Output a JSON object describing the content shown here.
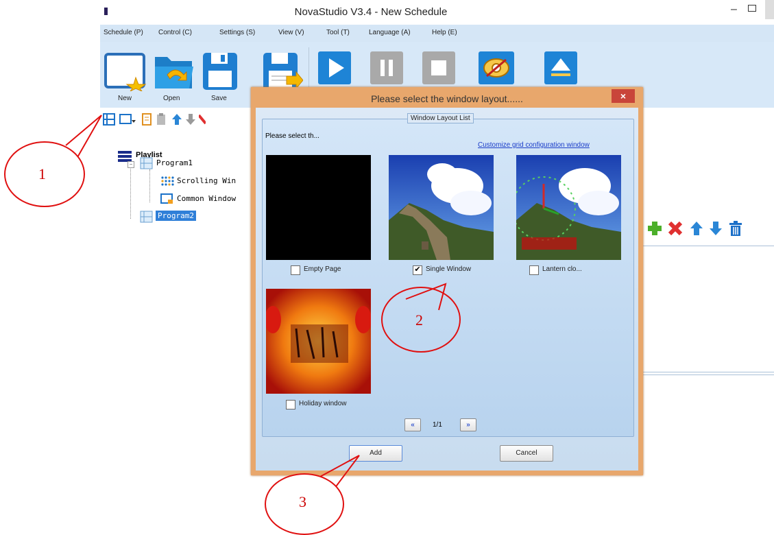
{
  "app": {
    "title": "NovaStudio V3.4 - New Schedule",
    "menu": [
      "Schedule (P)",
      "Control (C)",
      "Settings (S)",
      "View (V)",
      "Tool (T)",
      "Language (A)",
      "Help (E)"
    ],
    "toolbar": [
      {
        "label": "New",
        "icon": "new-window-icon"
      },
      {
        "label": "Open",
        "icon": "folder-open-icon"
      },
      {
        "label": "Save",
        "icon": "floppy-save-icon"
      },
      {
        "label": "",
        "icon": "save-as-icon"
      },
      {
        "label": "",
        "icon": "play-icon"
      },
      {
        "label": "",
        "icon": "pause-icon"
      },
      {
        "label": "",
        "icon": "stop-icon"
      },
      {
        "label": "",
        "icon": "preview-eye-icon"
      },
      {
        "label": "",
        "icon": "eject-icon"
      }
    ]
  },
  "playlist": {
    "root": "Playlist",
    "items": [
      {
        "label": "Program1",
        "selected": false
      },
      {
        "label": "Scrolling Win",
        "selected": false
      },
      {
        "label": "Common Window",
        "selected": false
      },
      {
        "label": "Program2",
        "selected": true
      }
    ]
  },
  "dialog": {
    "title": "Please select the window layout......",
    "close": "×",
    "group_title": "Window Layout List",
    "hint": "Please select th...",
    "customize_link": "Customize grid configuration window",
    "layouts": [
      {
        "label": "Empty Page",
        "checked": false
      },
      {
        "label": "Single Window",
        "checked": true
      },
      {
        "label": "Lantern clo...",
        "checked": false
      },
      {
        "label": "Holiday window",
        "checked": false
      }
    ],
    "pager": {
      "prev": "«",
      "page": "1/1",
      "next": "»"
    },
    "add_button": "Add",
    "cancel_button": "Cancel"
  },
  "annotations": [
    "1",
    "2",
    "3"
  ],
  "colors": {
    "accent_red": "#e01010",
    "dialog_border": "#e8a76c",
    "toolbar_bg": "#d7e8f8"
  }
}
